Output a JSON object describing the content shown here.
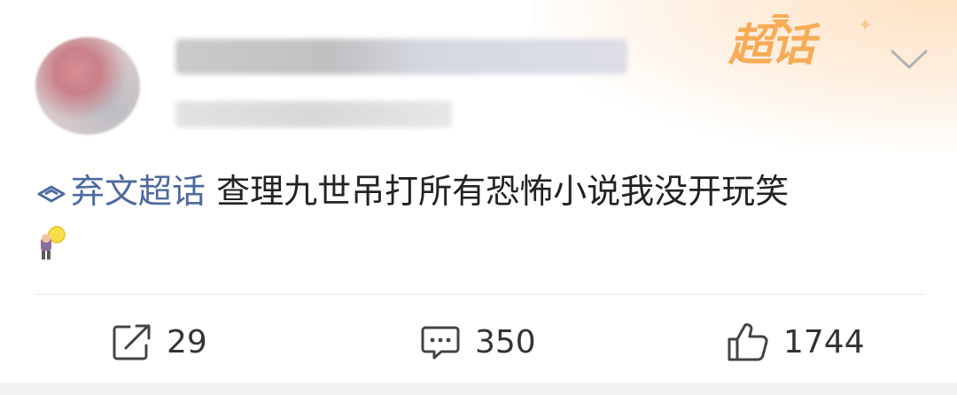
{
  "post": {
    "topic_badge": "超话",
    "content": {
      "topic_tag": "弃文超话",
      "text": "查理九世吊打所有恐怖小说我没开玩笑"
    },
    "emoji_icon": "lightbulb-kid-emoji"
  },
  "actions": {
    "repost_count": "29",
    "comment_count": "350",
    "like_count": "1744"
  },
  "icons": {
    "topic": "diamond-icon",
    "more": "chevron-down-icon",
    "repost": "share-icon",
    "comment": "comment-icon",
    "like": "thumbs-up-icon"
  },
  "colors": {
    "topic_link": "#4c6a9e",
    "badge": "#f7ab56",
    "text": "#222222"
  }
}
